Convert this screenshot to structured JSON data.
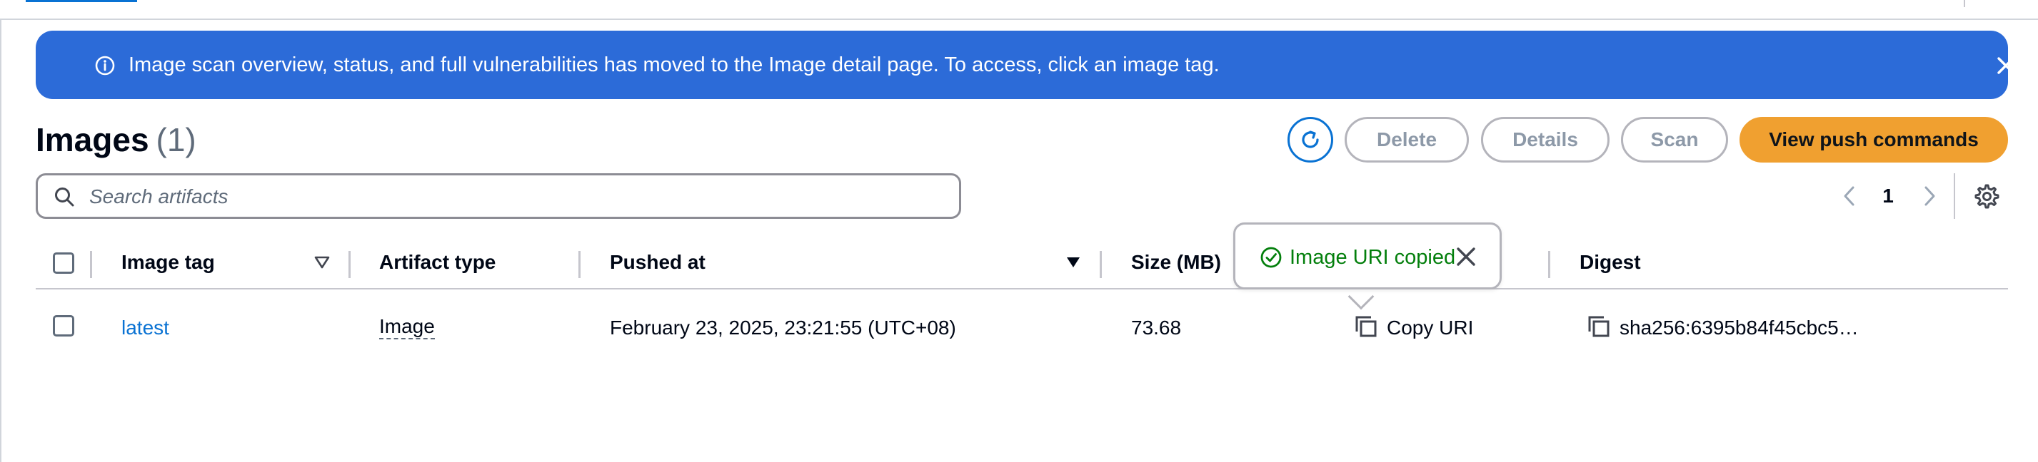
{
  "colors": {
    "banner_bg": "#2c6bd8",
    "primary_button": "#f0a030",
    "link": "#0972d3",
    "success": "#037f0c",
    "disabled_text": "#8d99a8"
  },
  "flash": {
    "icon": "info-icon",
    "message": "Image scan overview, status, and full vulnerabilities has moved to the Image detail page. To access, click an image tag.",
    "dismiss_icon": "close-icon"
  },
  "header": {
    "title": "Images",
    "count": "(1)",
    "refresh_icon": "refresh-icon",
    "buttons": {
      "delete": "Delete",
      "details": "Details",
      "scan": "Scan",
      "view_push_commands": "View push commands"
    }
  },
  "search": {
    "placeholder": "Search artifacts",
    "value": ""
  },
  "pagination": {
    "current_page": "1"
  },
  "table": {
    "columns": {
      "image_tag": "Image tag",
      "artifact_type": "Artifact type",
      "pushed_at": "Pushed at",
      "size": "Size (MB)",
      "digest": "Digest"
    },
    "rows": [
      {
        "image_tag": "latest",
        "artifact_type": "Image",
        "pushed_at": "February 23, 2025, 23:21:55 (UTC+08)",
        "size": "73.68",
        "uri_action": "Copy URI",
        "digest": "sha256:6395b84f45cbc5…"
      }
    ]
  },
  "popover": {
    "icon": "check-circle-icon",
    "message": "Image URI copied"
  }
}
